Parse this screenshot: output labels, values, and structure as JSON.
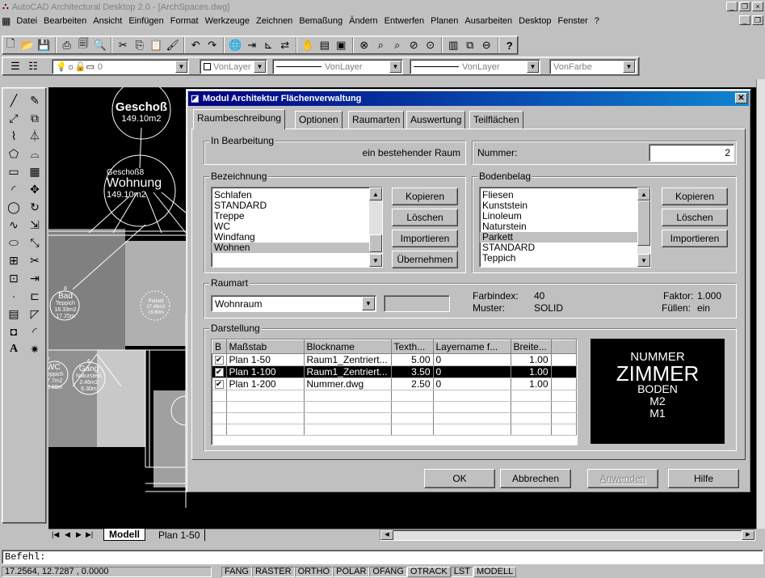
{
  "app": {
    "title": "AutoCAD Architectural Desktop 2.0 - [ArchSpaces.dwg]"
  },
  "menu": [
    "Datei",
    "Bearbeiten",
    "Ansicht",
    "Einfügen",
    "Format",
    "Werkzeuge",
    "Zeichnen",
    "Bemaßung",
    "Ändern",
    "Entwerfen",
    "Planen",
    "Ausarbeiten",
    "Desktop",
    "Fenster",
    "?"
  ],
  "props": {
    "layer_value": "0",
    "color_value": "VonLayer",
    "linetype_value": "VonLayer",
    "lineweight_value": "VonLayer",
    "plotstyle_value": "VonFarbe"
  },
  "drawing": {
    "label1_title": "Geschoß",
    "label1_area": "149.10m2",
    "label2_small": "Geschoß8",
    "label2_title": "Wohnung",
    "label2_area": "149.10m2",
    "bad_num": "8",
    "bad_name": "Bad",
    "bad_floor": "Teppich",
    "bad_a1": "18.33m2",
    "bad_a2": "17.25m",
    "p_floor": "Parkett",
    "p_a1": "17.48m2",
    "p_a2": "16.60m",
    "wc_num": "7",
    "wc_name": "WC",
    "wc_floor": "eppich",
    "wc_a1": "7.7m2",
    "wc_a2": "3.89m",
    "gang_num": "6",
    "gang_name": "Gang",
    "gang_floor": "Naturstein",
    "gang_a1": "2.46m2",
    "gang_a2": "6.30m"
  },
  "dialog": {
    "title": "Modul Architektur Flächenverwaltung",
    "tabs": [
      "Raumbeschreibung",
      "Optionen",
      "Raumarten",
      "Auswertung",
      "Teilflächen"
    ],
    "in_bearbeitung": {
      "legend": "In Bearbeitung",
      "value": "ein bestehender Raum"
    },
    "nummer": {
      "label": "Nummer:",
      "value": "2"
    },
    "bezeichnung": {
      "legend": "Bezeichnung",
      "items": [
        "Schlafen",
        "STANDARD",
        "Treppe",
        "WC",
        "Windfang",
        "Wohnen"
      ],
      "selected": "Wohnen",
      "buttons": [
        "Kopieren",
        "Löschen",
        "Importieren",
        "Übernehmen"
      ]
    },
    "bodenbelag": {
      "legend": "Bodenbelag",
      "items": [
        "Fliesen",
        "Kunststein",
        "Linoleum",
        "Naturstein",
        "Parkett",
        "STANDARD",
        "Teppich"
      ],
      "selected": "Parkett",
      "buttons": [
        "Kopieren",
        "Löschen",
        "Importieren"
      ]
    },
    "raumart": {
      "legend": "Raumart",
      "value": "Wohnraum",
      "farbindex_label": "Farbindex:",
      "farbindex_value": "40",
      "muster_label": "Muster:",
      "muster_value": "SOLID",
      "faktor_label": "Faktor:",
      "faktor_value": "1.000",
      "fuellen_label": "Füllen:",
      "fuellen_value": "ein"
    },
    "darstellung": {
      "legend": "Darstellung",
      "columns": [
        "B",
        "Maßstab",
        "Blockname",
        "Texth...",
        "Layername f...",
        "Breite..."
      ],
      "rows": [
        {
          "b": "✔",
          "scale": "Plan 1-50",
          "block": "Raum1_Zentriert...",
          "texth": "5.00",
          "layer": "0",
          "width": "1.00"
        },
        {
          "b": "✔",
          "scale": "Plan 1-100",
          "block": "Raum1_Zentriert...",
          "texth": "3.50",
          "layer": "0",
          "width": "1.00"
        },
        {
          "b": "✔",
          "scale": "Plan 1-200",
          "block": "Nummer.dwg",
          "texth": "2.50",
          "layer": "0",
          "width": "1.00"
        }
      ],
      "selected_row": 1,
      "preview": [
        "NUMMER",
        "ZIMMER",
        "BODEN",
        "M2",
        "M1"
      ]
    },
    "footer_buttons": {
      "ok": "OK",
      "cancel": "Abbrechen",
      "apply": "Anwenden",
      "help": "Hilfe"
    }
  },
  "layout_tabs": [
    "Modell",
    "Plan 1-50"
  ],
  "command": {
    "prompt": "Befehl:"
  },
  "status": {
    "coords": "17.2564, 12.7287 , 0.0000",
    "toggles": [
      "FANG",
      "RASTER",
      "ORTHO",
      "POLAR",
      "OFANG",
      "OTRACK",
      "LST",
      "MODELL"
    ]
  }
}
